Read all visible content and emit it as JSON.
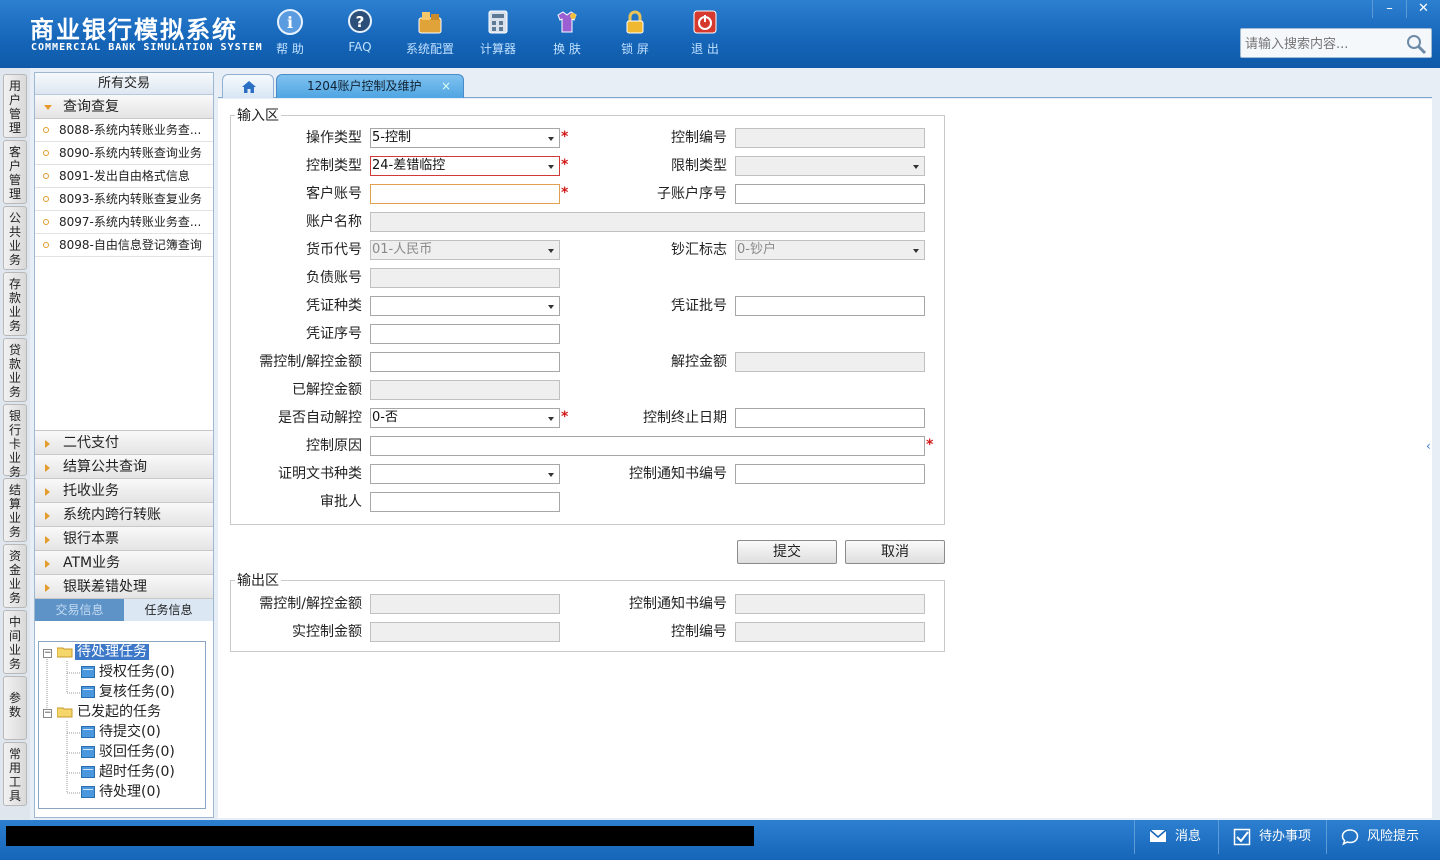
{
  "app": {
    "title_cn": "商业银行模拟系统",
    "title_en": "COMMERCIAL BANK SIMULATION SYSTEM"
  },
  "toolbar": [
    {
      "label": "帮 助",
      "icon": "help-icon"
    },
    {
      "label": "FAQ",
      "icon": "faq-icon"
    },
    {
      "label": "系统配置",
      "icon": "config-icon"
    },
    {
      "label": "计算器",
      "icon": "calculator-icon"
    },
    {
      "label": "换 肤",
      "icon": "skin-icon"
    },
    {
      "label": "锁 屏",
      "icon": "lock-icon"
    },
    {
      "label": "退 出",
      "icon": "exit-icon"
    }
  ],
  "window": {
    "minimize": "–",
    "close": "✕"
  },
  "search": {
    "placeholder": "请输入搜索内容..."
  },
  "vertical_tabs": [
    "用户管理",
    "客户管理",
    "公共业务",
    "存款业务",
    "贷款业务",
    "银行卡业务",
    "结算业务",
    "资金业务",
    "中间业务",
    "参数",
    "常用工具"
  ],
  "sidebar": {
    "title": "所有交易",
    "open_group": "查询查复",
    "items": [
      "8088-系统内转账业务查...",
      "8090-系统内转账查询业务",
      "8091-发出自由格式信息",
      "8093-系统内转账查复业务",
      "8097-系统内转账业务查...",
      "8098-自由信息登记簿查询"
    ],
    "groups": [
      "二代支付",
      "结算公共查询",
      "托收业务",
      "系统内跨行转账",
      "银行本票",
      "ATM业务",
      "银联差错处理"
    ],
    "bottom_tabs": [
      "交易信息",
      "任务信息"
    ],
    "tree": {
      "pending": "待处理任务",
      "pending_children": [
        "授权任务(0)",
        "复核任务(0)"
      ],
      "initiated": "已发起的任务",
      "initiated_children": [
        "待提交(0)",
        "驳回任务(0)",
        "超时任务(0)",
        "待处理(0)"
      ]
    }
  },
  "tab": {
    "active_title": "1204账户控制及维护",
    "close": "×"
  },
  "input_area": {
    "legend": "输入区",
    "labels": {
      "op_type": "操作类型",
      "ctrl_no": "控制编号",
      "ctrl_type": "控制类型",
      "limit_type": "限制类型",
      "cust_acct": "客户账号",
      "sub_acct": "子账户序号",
      "acct_name": "账户名称",
      "currency": "货币代号",
      "cash_flag": "钞汇标志",
      "debt_acct": "负债账号",
      "voucher_type": "凭证种类",
      "voucher_batch": "凭证批号",
      "voucher_seq": "凭证序号",
      "need_amt": "需控制/解控金额",
      "release_amt": "解控金额",
      "released_amt": "已解控金额",
      "auto_release": "是否自动解控",
      "end_date": "控制终止日期",
      "reason": "控制原因",
      "cert_type": "证明文书种类",
      "notice_no": "控制通知书编号",
      "approver": "审批人"
    },
    "values": {
      "op_type": "5-控制",
      "ctrl_type": "24-差错临控",
      "currency": "01-人民币",
      "cash_flag": "0-钞户",
      "auto_release": "0-否"
    },
    "required_mark": "*"
  },
  "buttons": {
    "submit": "提交",
    "cancel": "取消"
  },
  "output_area": {
    "legend": "输出区",
    "labels": {
      "need_amt": "需控制/解控金额",
      "notice_no": "控制通知书编号",
      "actual_amt": "实控制金额",
      "ctrl_no": "控制编号"
    }
  },
  "footer": {
    "message": "消息",
    "todo": "待办事项",
    "risk": "风险提示"
  },
  "colors": {
    "header_blue": "#1565b8",
    "active_tab": "#4fa5e2",
    "required": "#d01818",
    "tree_selected": "#3d78c8"
  }
}
